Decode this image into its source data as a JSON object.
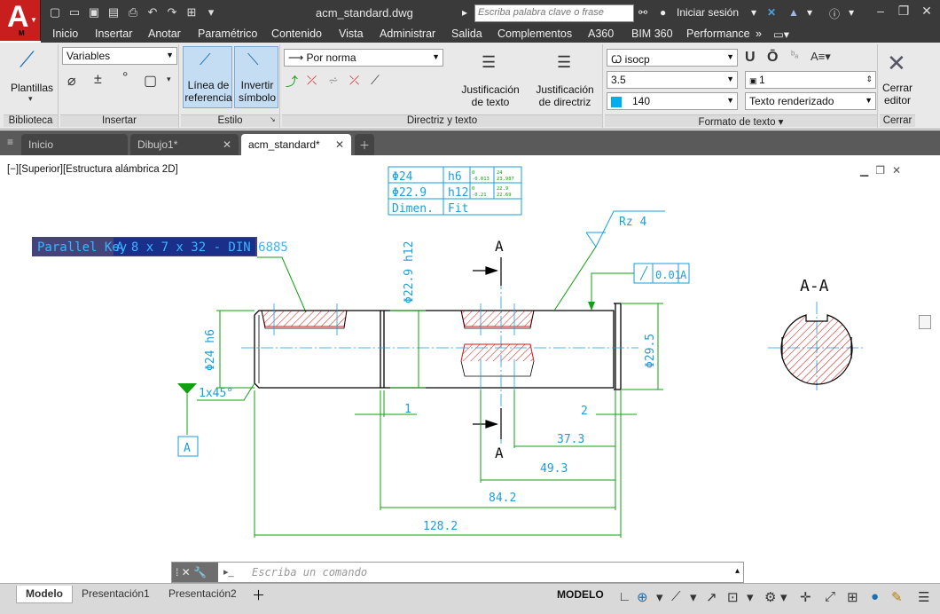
{
  "app": {
    "logo_letter": "A",
    "logo_sub": "M",
    "doc_title": "acm_standard.dwg"
  },
  "search": {
    "placeholder": "Escriba palabra clave o frase"
  },
  "account": {
    "login": "Iniciar sesión"
  },
  "menu": [
    "Inicio",
    "Insertar",
    "Anotar",
    "Paramétrico",
    "Contenido",
    "Vista",
    "Administrar",
    "Salida",
    "Complementos",
    "A360",
    "BIM 360",
    "Performance"
  ],
  "ribbon": {
    "biblioteca": {
      "title": "Biblioteca",
      "templates": "Plantillas"
    },
    "insertar": {
      "title": "Insertar",
      "variables": "Variables"
    },
    "estilo": {
      "title": "Estilo",
      "linea": "Línea de\nreferencia",
      "invertir": "Invertir\nsímbolo"
    },
    "directriz": {
      "title": "Directriz y texto",
      "por_norma": "Por norma",
      "just_texto": "Justificación\nde texto",
      "just_directriz": "Justificación\nde directriz"
    },
    "formato": {
      "title": "Formato de texto",
      "font": "isocp",
      "height": "3.5",
      "color": "140",
      "width_factor": "1",
      "render": "Texto renderizado",
      "u": "U",
      "o": "Ō"
    },
    "cerrar": {
      "title": "Cerrar",
      "label": "Cerrar\neditor"
    }
  },
  "doc_tabs": [
    {
      "label": "Inicio"
    },
    {
      "label": "Dibujo1*"
    },
    {
      "label": "acm_standard*"
    }
  ],
  "viewport": {
    "label": "[−][Superior][Estructura alámbrica 2D]"
  },
  "drawing": {
    "tol_table": [
      [
        "Φ24",
        "h6",
        "0\n-0.013",
        "24\n23.987"
      ],
      [
        "Φ22.9",
        "h12",
        "0\n-0.21",
        "22.9\n22.69"
      ],
      [
        "Dimen.",
        "Fit",
        "",
        ""
      ]
    ],
    "parallel_key_a": "Parallel Key",
    "parallel_key_b": "A 8 x 7 x 32 - DIN 6885",
    "rz": "Rz 4",
    "section_a": "A",
    "section_view": "A-A",
    "chamfer": "1x45°",
    "datum": "A",
    "geo_tol_value": "0.01",
    "geo_tol_ref": "A",
    "dims": {
      "d229": "Φ22.9 h12",
      "d24": "Φ24 h6",
      "d295": "Φ29.5",
      "d1": "1",
      "d2": "2",
      "d373": "37.3",
      "d493": "49.3",
      "d842": "84.2",
      "d1282": "128.2"
    }
  },
  "command": {
    "placeholder": "Escriba un comando"
  },
  "layout_tabs": [
    "Modelo",
    "Presentación1",
    "Presentación2"
  ],
  "status": {
    "mode": "MODELO"
  },
  "colors": {
    "cyan": "#1a9fd9",
    "green": "#10a010",
    "red": "#e01010",
    "accent": "#c81e1e"
  }
}
